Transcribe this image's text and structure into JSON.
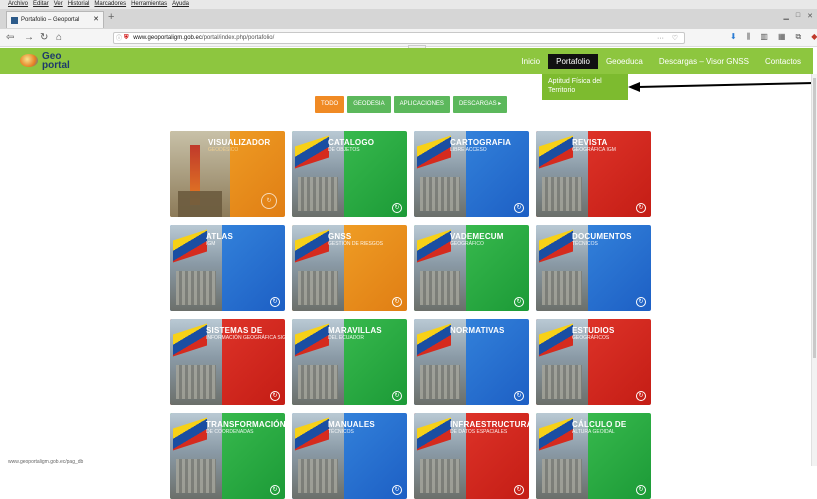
{
  "browser": {
    "menu": [
      "Archivo",
      "Editar",
      "Ver",
      "Historial",
      "Marcadores",
      "Herramientas",
      "Ayuda"
    ],
    "tab_title": "Portafolio – Geoportal Ecuador",
    "url_host": "www.geoportaligm.gob.ec",
    "url_path": "/portal/index.php/portafolio/",
    "status_url": "www.geoportaligm.gob.ec/pag_db"
  },
  "site": {
    "logo_text": "Geo portal",
    "nav": [
      "Inicio",
      "Portafolio",
      "Geoeduca",
      "Descargas – Visor GNSS",
      "Contactos"
    ],
    "active_nav": "Portafolio",
    "dropdown_item": "Aptitud Física del Territorio"
  },
  "filters": [
    "TODO",
    "GEODESIA",
    "APLICACIONES",
    "DESCARGAS"
  ],
  "tiles": [
    {
      "title": "VISUALIZADOR",
      "subtitle": "GEODÉSICO",
      "color": "orange"
    },
    {
      "title": "CATALOGO",
      "subtitle": "DE OBJETOS",
      "color": "green"
    },
    {
      "title": "CARTOGRAFIA",
      "subtitle": "LIBRE ACCESO",
      "color": "blue"
    },
    {
      "title": "REVISTA",
      "subtitle": "GEOGRÁFICA IGM",
      "color": "red"
    },
    {
      "title": "ATLAS",
      "subtitle": "IGM",
      "color": "blue"
    },
    {
      "title": "GNSS",
      "subtitle": "GESTIÓN DE RIESGOS",
      "color": "orange"
    },
    {
      "title": "VADEMECUM",
      "subtitle": "GEOGRÁFICO",
      "color": "green"
    },
    {
      "title": "DOCUMENTOS",
      "subtitle": "TÉCNICOS",
      "color": "blue"
    },
    {
      "title": "SISTEMAS DE",
      "subtitle": "INFORMACIÓN GEOGRÁFICA SIG",
      "color": "red"
    },
    {
      "title": "MARAVILLAS",
      "subtitle": "DEL ECUADOR",
      "color": "green"
    },
    {
      "title": "NORMATIVAS",
      "subtitle": "",
      "color": "blue"
    },
    {
      "title": "ESTUDIOS",
      "subtitle": "GEOGRÁFICOS",
      "color": "red"
    },
    {
      "title": "TRANSFORMACIÓN",
      "subtitle": "DE COORDENADAS",
      "color": "green"
    },
    {
      "title": "MANUALES",
      "subtitle": "TÉCNICOS",
      "color": "blue"
    },
    {
      "title": "INFRAESTRUCTURA",
      "subtitle": "DE DATOS ESPACIALES",
      "color": "red"
    },
    {
      "title": "CÁLCULO DE",
      "subtitle": "ALTURA GEOIDAL",
      "color": "green"
    }
  ]
}
